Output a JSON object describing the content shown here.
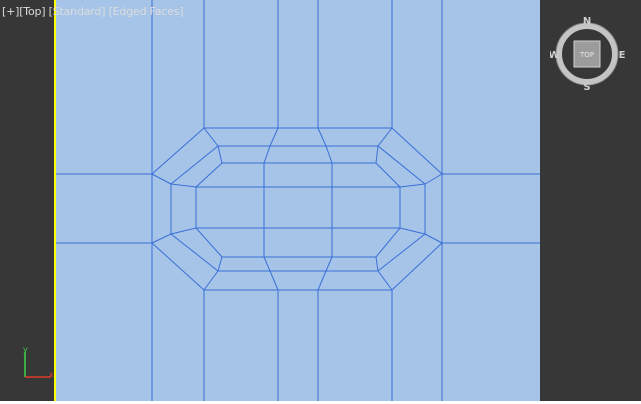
{
  "viewport": {
    "labels": {
      "plus": "[+]",
      "view": "[Top]",
      "shading": "[Standard]",
      "edged": "[Edged Faces]"
    },
    "viewcube": {
      "face": "TOP",
      "north": "N",
      "south": "S",
      "east": "E",
      "west": "W"
    },
    "axis": {
      "y": "y",
      "x": "x"
    },
    "colors": {
      "background": "#373737",
      "mesh_fill": "#a6c4e8",
      "mesh_wire": "#3a6fd6",
      "active_border": "#ffff00"
    }
  }
}
